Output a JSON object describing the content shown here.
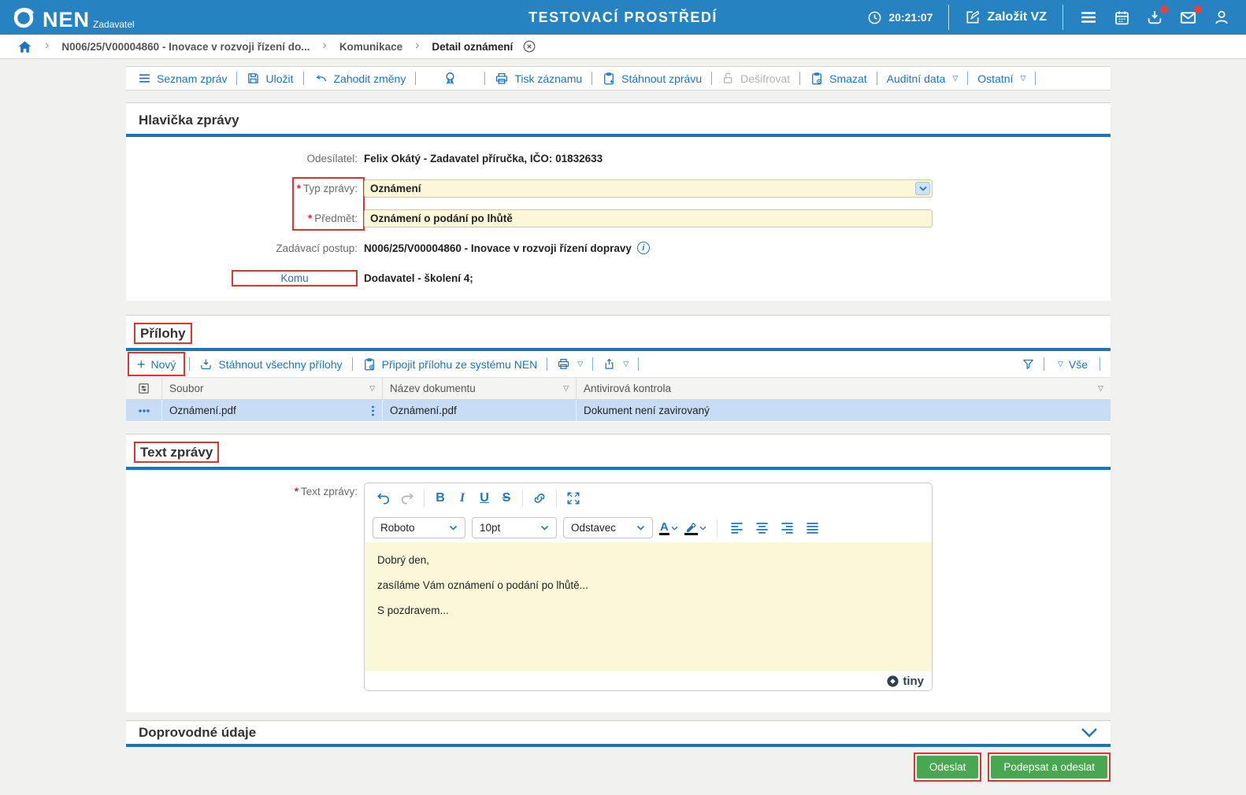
{
  "topbar": {
    "brand": "NEN",
    "brand_sub": "Zadavatel",
    "env_title": "TESTOVACÍ PROSTŘEDÍ",
    "time": "20:21:07",
    "create_label": "Založit VZ"
  },
  "breadcrumb": {
    "items": [
      "N006/25/V00004860 - Inovace v rozvoji řízení do...",
      "Komunikace",
      "Detail oznámení"
    ]
  },
  "toolbar": {
    "seznam": "Seznam zpráv",
    "ulozit": "Uložit",
    "zahodit": "Zahodit změny",
    "tisk": "Tisk záznamu",
    "stahnout_zpravu": "Stáhnout zprávu",
    "desifrovat": "Dešifrovat",
    "smazat": "Smazat",
    "auditni": "Auditní data",
    "ostatni": "Ostatní"
  },
  "hlavicka": {
    "title": "Hlavička zprávy",
    "required_mark": "*",
    "odesilatel_label": "Odesílatel:",
    "odesilatel": "Felix Okátý - Zadavatel příručka, IČO: 01832633",
    "typ_label": "Typ zprávy:",
    "typ": "Oznámení",
    "predmet_label": "Předmět:",
    "predmet": "Oznámení o podání po lhůtě",
    "postup_label": "Zadávací postup:",
    "postup": "N006/25/V00004860 - Inovace v rozvoji řízení dopravy",
    "komu_label": "Komu",
    "komu": "Dodavatel - školení 4;"
  },
  "prilohy": {
    "title": "Přílohy",
    "novy": "Nový",
    "stahnout_vse": "Stáhnout všechny přílohy",
    "pripojit": "Připojit přílohu ze systému NEN",
    "vse": "Vše",
    "columns": [
      "Soubor",
      "Název dokumentu",
      "Antivirová kontrola"
    ],
    "rows": [
      {
        "soubor": "Oznámení.pdf",
        "nazev": "Oznámení.pdf",
        "antivir": "Dokument není zavirovaný"
      }
    ]
  },
  "text_zpravy": {
    "title": "Text zprávy",
    "label": "Text zprávy:",
    "font": "Roboto",
    "size": "10pt",
    "paragraph": "Odstavec",
    "lines": [
      "Dobrý den,",
      "zasíláme Vám oznámení o podání po lhůtě...",
      "S pozdravem..."
    ],
    "tiny_label": "tiny"
  },
  "doprovodne": {
    "title": "Doprovodné údaje"
  },
  "actions": {
    "odeslat": "Odeslat",
    "podepsat": "Podepsat a odeslat"
  },
  "icons": {
    "triangle_down": "▽",
    "plus": "+",
    "chevron_sep": "›",
    "info_i": "i"
  },
  "colors": {
    "topbar_blue": "#2682c0",
    "accent_blue": "#1c75bc",
    "field_yellow": "#fbf7d9",
    "selected_row_blue": "#c8dcf5",
    "button_green": "#4aa751",
    "annotation_red": "#e0342f"
  }
}
